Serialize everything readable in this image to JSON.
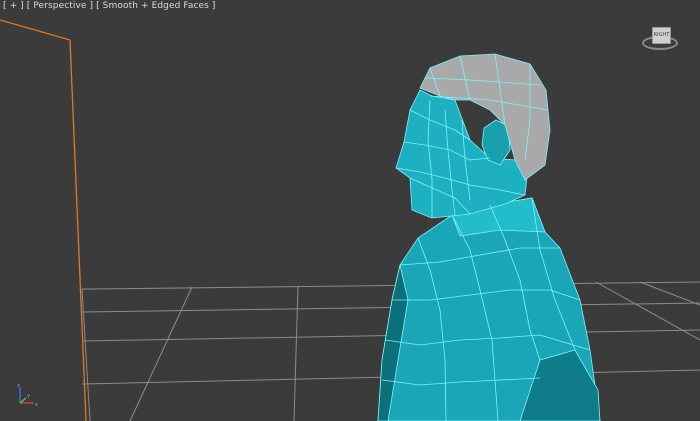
{
  "viewport": {
    "label_plus": "[ + ]",
    "label_view": "[ Perspective ]",
    "label_shading": "[ Smooth + Edged Faces ]"
  },
  "viewcube": {
    "face_label": "RIGHT"
  },
  "axis_tripod": {
    "z_label": "z",
    "y_label": "y",
    "x_label": "x"
  },
  "colors": {
    "background": "#3b3b3b",
    "grid": "#8c8c8c",
    "model_fill": "#19a9b9",
    "model_edges": "#7ef2ff",
    "hair_fill": "#a9a9a9",
    "selection_line": "#d97a2b"
  }
}
